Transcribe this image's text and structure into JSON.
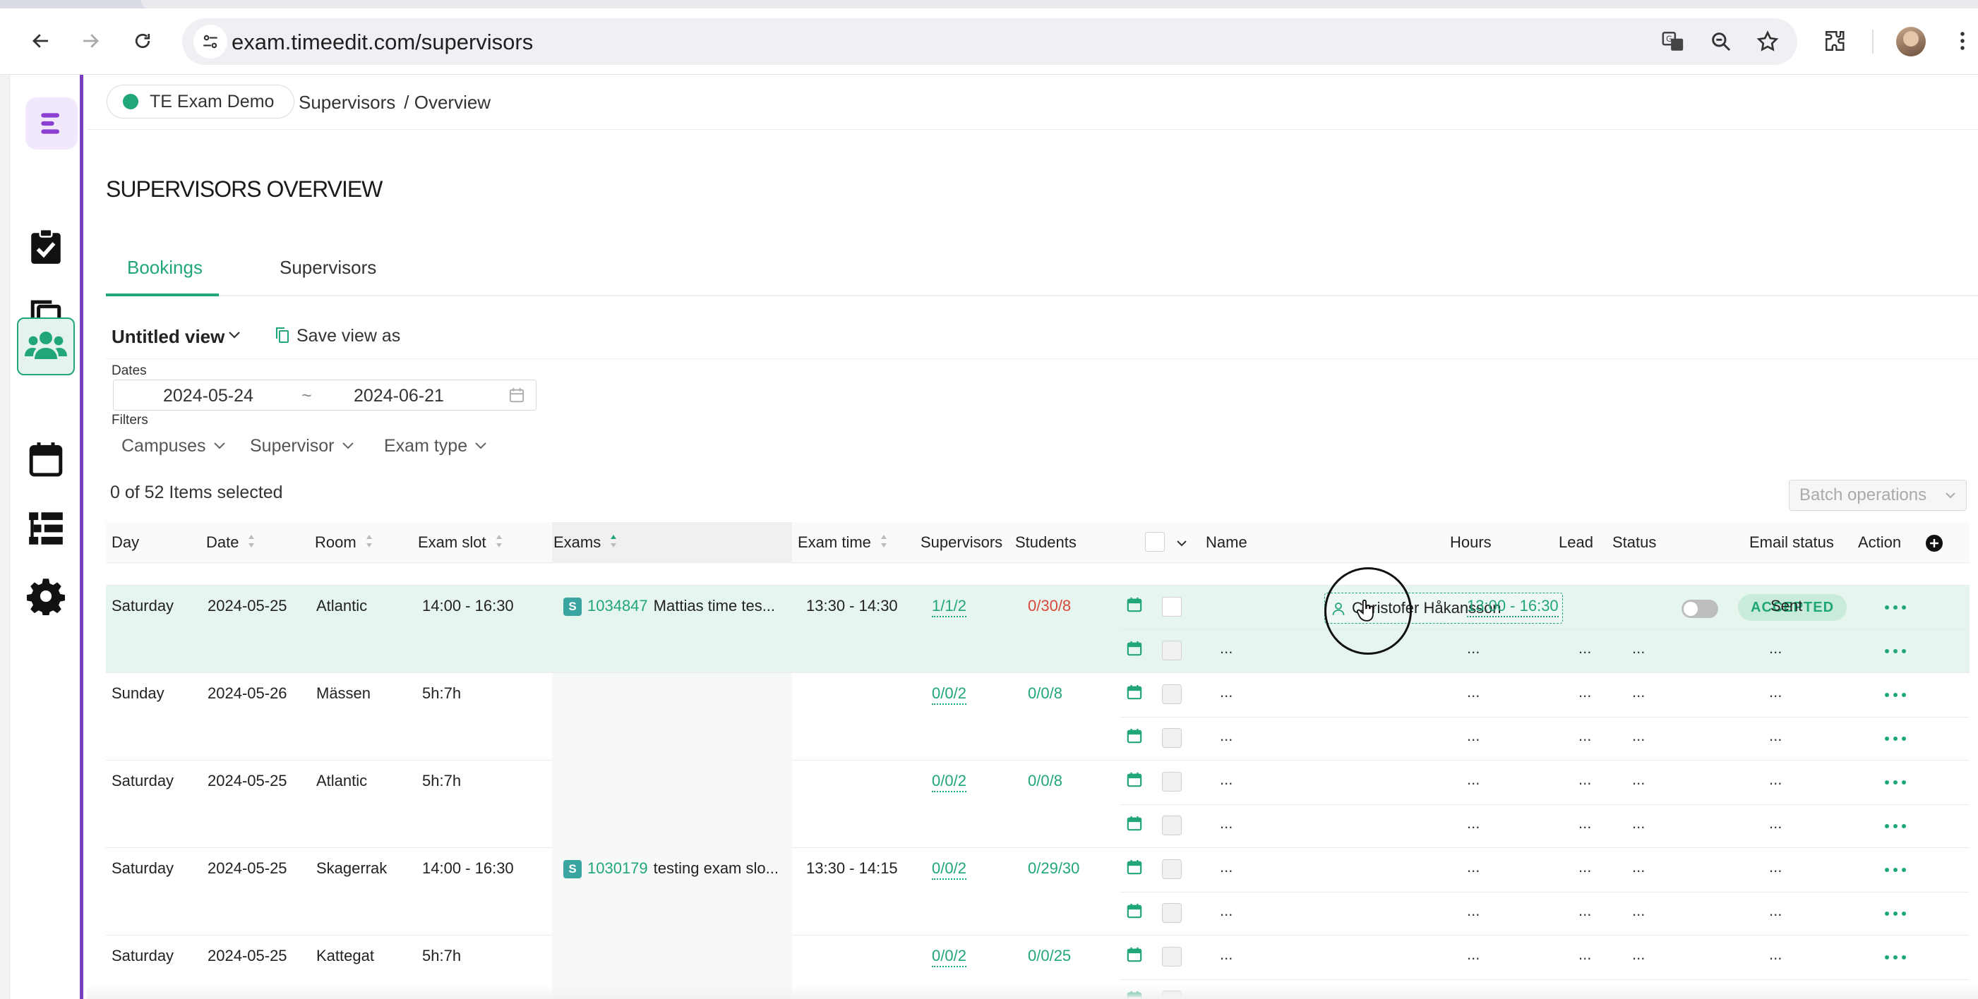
{
  "browser": {
    "url": "exam.timeedit.com/supervisors",
    "icons": [
      "back-icon",
      "forward-icon",
      "reload-icon",
      "site-settings-icon",
      "translate-icon",
      "zoom-icon",
      "bookmark-star-icon",
      "extensions-icon",
      "profile-avatar",
      "browser-menu-icon"
    ]
  },
  "sidebar": {
    "items": [
      {
        "name": "exams",
        "icon": "clipboard-check-icon"
      },
      {
        "name": "documents",
        "icon": "copy-icon"
      },
      {
        "name": "supervisors",
        "icon": "users-icon",
        "active": true
      },
      {
        "name": "calendar",
        "icon": "calendar-icon"
      },
      {
        "name": "lists",
        "icon": "list-icon"
      },
      {
        "name": "settings",
        "icon": "gear-icon"
      }
    ]
  },
  "header": {
    "org": "TE Exam Demo",
    "breadcrumb": [
      "Supervisors",
      "/ Overview"
    ]
  },
  "page": {
    "title": "SUPERVISORS OVERVIEW",
    "tabs": [
      "Bookings",
      "Supervisors"
    ],
    "active_tab": "Bookings"
  },
  "view": {
    "name": "Untitled view",
    "save_label": "Save view as"
  },
  "dates": {
    "label": "Dates",
    "start": "2024-05-24",
    "separator": "~",
    "end": "2024-06-21"
  },
  "filters": {
    "label": "Filters",
    "items": [
      "Campuses",
      "Supervisor",
      "Exam type"
    ]
  },
  "selection": {
    "text": "0 of 52 Items selected",
    "batch_label": "Batch operations"
  },
  "table": {
    "columns": [
      "Day",
      "Date",
      "Room",
      "Exam slot",
      "Exams",
      "Exam time",
      "Supervisors",
      "Students",
      "Name",
      "Hours",
      "Lead",
      "Status",
      "Email status",
      "Action"
    ],
    "placeholder": "...",
    "rows": [
      {
        "day": "Saturday",
        "date": "2024-05-25",
        "room": "Atlantic",
        "slot": "14:00 - 16:30",
        "exam_badge": "S",
        "exam_id": "1034847",
        "exam_title": "Mattias time tes...",
        "exam_time": "13:30 - 14:30",
        "supervisors": "1/1/2",
        "students": "0/30/8",
        "assignment": {
          "name": "Christofer Håkansson",
          "hours": "13:00 - 16:30",
          "lead": false,
          "status": "ACCEPTED",
          "email_status": "Sent"
        }
      },
      {
        "day": "Sunday",
        "date": "2024-05-26",
        "room": "Mässen",
        "slot": "5h:7h",
        "exam_badge": "",
        "exam_id": "",
        "exam_title": "",
        "exam_time": "",
        "supervisors": "0/0/2",
        "students": "0/0/8"
      },
      {
        "day": "Saturday",
        "date": "2024-05-25",
        "room": "Atlantic",
        "slot": "5h:7h",
        "exam_badge": "",
        "exam_id": "",
        "exam_title": "",
        "exam_time": "",
        "supervisors": "0/0/2",
        "students": "0/0/8"
      },
      {
        "day": "Saturday",
        "date": "2024-05-25",
        "room": "Skagerrak",
        "slot": "14:00 - 16:30",
        "exam_badge": "S",
        "exam_id": "1030179",
        "exam_title": "testing exam slo...",
        "exam_time": "13:30 - 14:15",
        "supervisors": "0/0/2",
        "students": "0/29/30"
      },
      {
        "day": "Saturday",
        "date": "2024-05-25",
        "room": "Kattegat",
        "slot": "5h:7h",
        "exam_badge": "",
        "exam_id": "",
        "exam_title": "",
        "exam_time": "",
        "supervisors": "0/0/2",
        "students": "0/0/25"
      }
    ]
  },
  "colors": {
    "accent": "#21a67a",
    "sidebar_border": "#7a3fc0",
    "students_over": "#d9473b",
    "selected_row": "#e7f5ef"
  }
}
